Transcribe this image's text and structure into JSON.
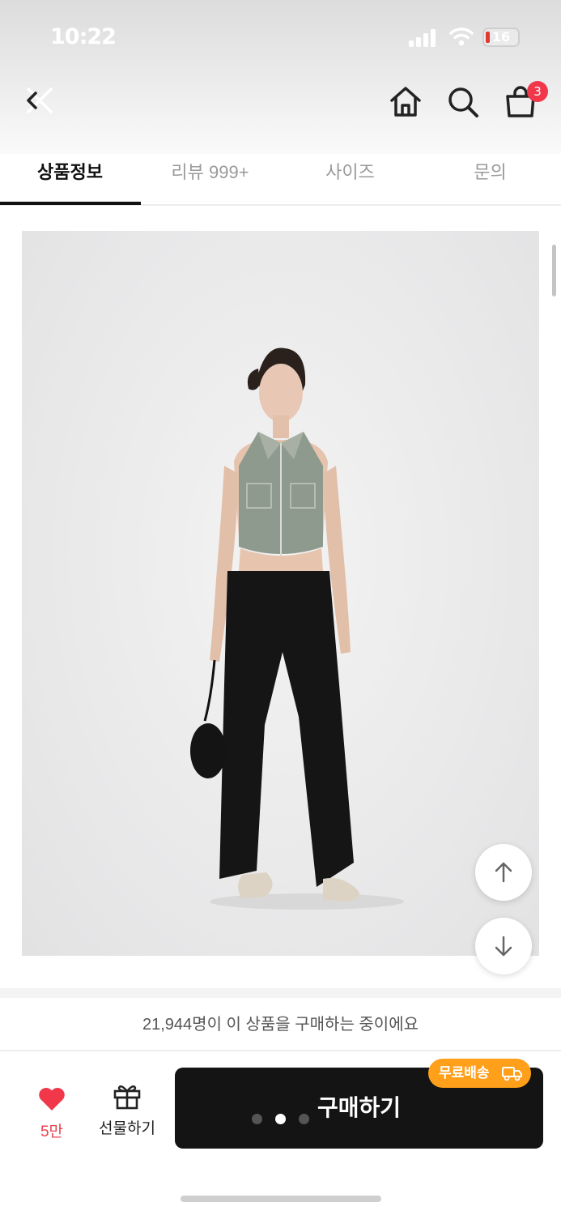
{
  "status_bar": {
    "time": "10:22",
    "battery": "16"
  },
  "header": {
    "cart_count": "3"
  },
  "tabs": [
    {
      "label": "상품정보",
      "active": true
    },
    {
      "label": "리뷰 999+",
      "active": false
    },
    {
      "label": "사이즈",
      "active": false
    },
    {
      "label": "문의",
      "active": false
    }
  ],
  "purchase_notice": "21,944명이 이 상품을 구매하는 중이에요",
  "bottom_bar": {
    "like_count": "5만",
    "gift_label": "선물하기",
    "buy_label": "구매하기",
    "free_shipping": "무료배송"
  },
  "carousel": {
    "total": 3,
    "active_index": 1
  },
  "colors": {
    "accent_red": "#f0384a",
    "shipping_orange": "#ff9f1a",
    "buy_button_bg": "#141414"
  },
  "icons": [
    "close-icon",
    "home-icon",
    "search-icon",
    "shopping-bag-icon",
    "arrow-up-icon",
    "arrow-down-icon",
    "heart-icon",
    "gift-icon",
    "truck-icon",
    "signal-icon",
    "wifi-icon"
  ]
}
